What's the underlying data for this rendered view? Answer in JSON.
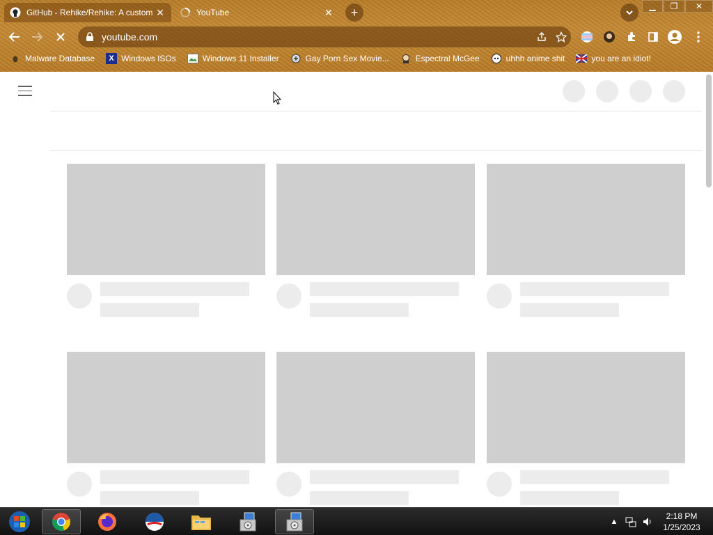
{
  "browser": {
    "tabs": [
      {
        "title": "GitHub - Rehike/Rehike: A custom",
        "active": true,
        "favicon": "github-icon"
      },
      {
        "title": "YouTube",
        "active": false,
        "favicon": "loading-icon"
      }
    ],
    "new_tab_label": "+",
    "url": "youtube.com",
    "bookmarks": [
      {
        "label": "Malware Database",
        "icon": "bug-icon"
      },
      {
        "label": "Windows ISOs",
        "icon": "x-logo-icon"
      },
      {
        "label": "Windows 11 Installer",
        "icon": "image-icon"
      },
      {
        "label": "Gay Porn Sex Movie...",
        "icon": "site-icon"
      },
      {
        "label": "Espectral McGee",
        "icon": "character-icon"
      },
      {
        "label": "uhhh anime shit",
        "icon": "anime-icon"
      },
      {
        "label": "you are an idiot!",
        "icon": "flag-icon"
      }
    ]
  },
  "page": {
    "loading": true,
    "skeleton_cards": 6
  },
  "taskbar": {
    "apps": [
      "start-orb",
      "chrome",
      "firefox",
      "ie-like",
      "explorer",
      "installer",
      "installer"
    ],
    "clock_time": "2:18 PM",
    "clock_date": "1/25/2023"
  },
  "colors": {
    "theme": "#b77e2c",
    "skeleton_thumb": "#cfcfcf",
    "skeleton_light": "#ececec"
  }
}
